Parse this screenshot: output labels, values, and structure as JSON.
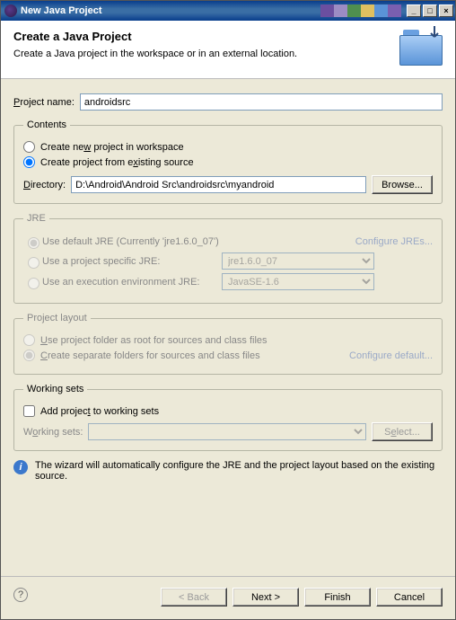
{
  "window": {
    "title": "New Java Project"
  },
  "banner": {
    "heading": "Create a Java Project",
    "sub": "Create a Java project in the workspace or in an external location."
  },
  "project": {
    "label": "Project name:",
    "value": "androidsrc"
  },
  "contents": {
    "legend": "Contents",
    "opt_new": "Create new project in workspace",
    "opt_existing": "Create project from existing source",
    "dir_label": "Directory:",
    "dir_value": "D:\\Android\\Android Src\\androidsrc\\myandroid",
    "browse": "Browse..."
  },
  "jre": {
    "legend": "JRE",
    "opt_default": "Use default JRE (Currently 'jre1.6.0_07')",
    "configure": "Configure JREs...",
    "opt_specific": "Use a project specific JRE:",
    "specific_value": "jre1.6.0_07",
    "opt_env": "Use an execution environment JRE:",
    "env_value": "JavaSE-1.6"
  },
  "layout": {
    "legend": "Project layout",
    "opt_root": "Use project folder as root for sources and class files",
    "opt_sep": "Create separate folders for sources and class files",
    "configure": "Configure default..."
  },
  "ws": {
    "legend": "Working sets",
    "check": "Add project to working sets",
    "label": "Working sets:",
    "value": "",
    "select": "Select..."
  },
  "info": "The wizard will automatically configure the JRE and the project layout based on the existing source.",
  "buttons": {
    "back": "< Back",
    "next": "Next >",
    "finish": "Finish",
    "cancel": "Cancel"
  }
}
